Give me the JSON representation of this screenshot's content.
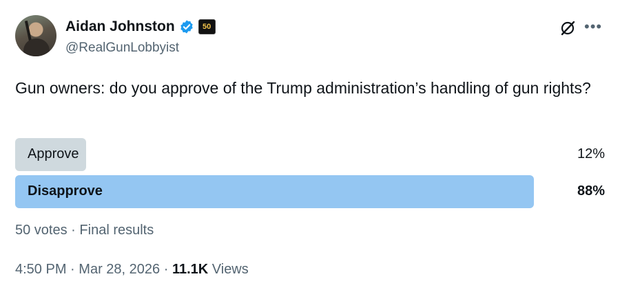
{
  "author": {
    "display_name": "Aidan Johnston",
    "handle": "@RealGunLobbyist",
    "badge_text": "50"
  },
  "post": {
    "text": "Gun owners: do you approve of the Trump administration’s handling of gun rights?"
  },
  "poll": {
    "options": [
      {
        "label": "Approve",
        "percent_text": "12%",
        "percent": 12
      },
      {
        "label": "Disapprove",
        "percent_text": "88%",
        "percent": 88
      }
    ],
    "votes": "50 votes",
    "separator": "·",
    "status": "Final results"
  },
  "meta": {
    "time": "4:50 PM",
    "separator": "·",
    "date": "Mar 28, 2026",
    "views_count": "11.1K",
    "views_label": "Views"
  },
  "colors": {
    "verified": "#1d9bf0",
    "winner_fill": "#94c6f2",
    "loser_fill": "#cfd9de",
    "secondary_text": "#536471"
  },
  "icons": [
    "verified-badge-icon",
    "grok-icon",
    "more-options-icon"
  ]
}
